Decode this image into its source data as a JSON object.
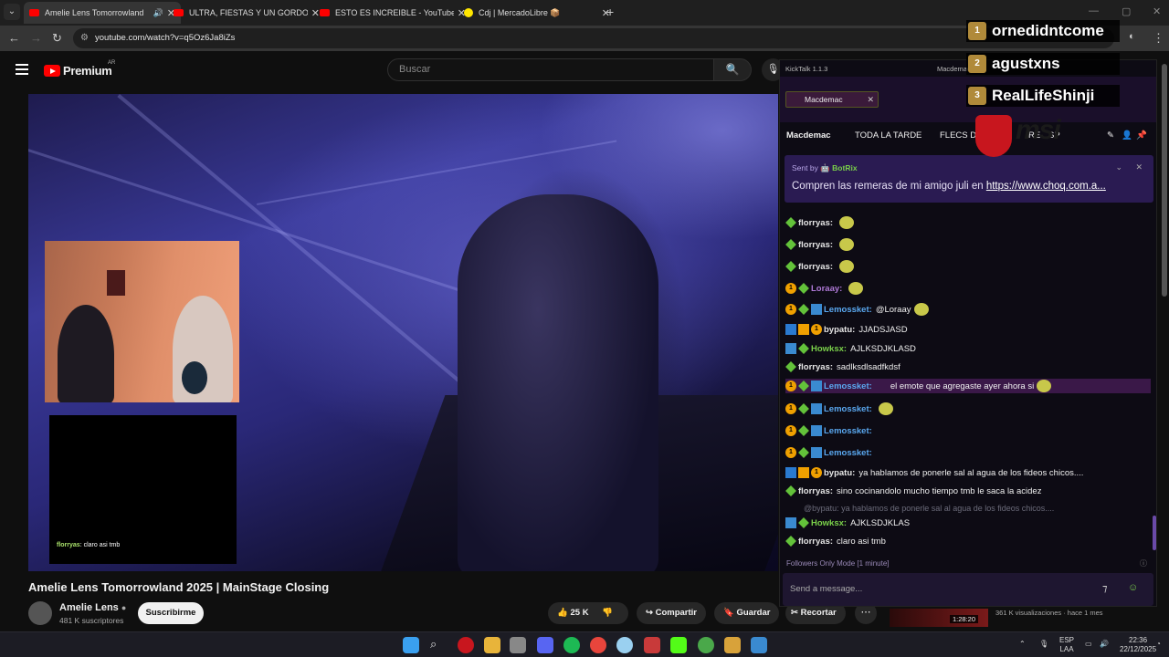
{
  "browser": {
    "tabs": [
      {
        "title": "Amelie Lens Tomorrowland",
        "active": true,
        "audio": true
      },
      {
        "title": "ULTRA, FIESTAS Y UN GORDO E",
        "active": false
      },
      {
        "title": "ESTO ES INCREIBLE - YouTube",
        "active": false
      },
      {
        "title": "Cdj | MercadoLibre 📦",
        "active": false
      }
    ],
    "url": "youtube.com/watch?v=q5Oz6Ja8iZs"
  },
  "youtube": {
    "logo_word": "Premium",
    "country_code": "AR",
    "search_placeholder": "Buscar",
    "video_title": "Amelie Lens Tomorrowland 2025 | MainStage Closing",
    "channel_name": "Amelie Lens",
    "subscribers": "481 K suscriptores",
    "subscribe_label": "Suscribirme",
    "likes": "25 K",
    "share_label": "Compartir",
    "save_label": "Guardar",
    "clip_label": "Recortar",
    "related": {
      "duration": "1:28:20",
      "meta": "361 K visualizaciones · hace 1 mes"
    }
  },
  "webcam_chat": {
    "user": "florryas",
    "text": ": claro asi tmb"
  },
  "kicktalk": {
    "app_title": "KickTalk 1.1.3",
    "window_title": "Macdemac",
    "tab_chip": "Macdemac",
    "nav": [
      "Macdemac",
      "TODA LA TARDE",
      "FLECS D",
      "RE",
      "SP"
    ],
    "pinned": {
      "sent_by": "Sent by",
      "bot": "BotRix",
      "message": "Compren las remeras de mi amigo juli en ",
      "link": "https://www.choq.com.a..."
    },
    "messages": [
      {
        "user": "florryas:",
        "color": "#e6e6e6",
        "text": ""
      },
      {
        "user": "florryas:",
        "color": "#e6e6e6",
        "text": ""
      },
      {
        "user": "florryas:",
        "color": "#e6e6e6",
        "text": ""
      },
      {
        "user": "Loraay:",
        "color": "#b07ad8",
        "text": ""
      },
      {
        "user": "Lemossket:",
        "color": "#5aa8f0",
        "text": "@Loraay"
      },
      {
        "user": "bypatu:",
        "color": "#e6e6e6",
        "text": "JJADSJASD"
      },
      {
        "user": "Howksx:",
        "color": "#7ad04a",
        "text": "AJLKSDJKLASD"
      },
      {
        "user": "florryas:",
        "color": "#e6e6e6",
        "text": "sadlksdlsadfkdsf"
      },
      {
        "user": "Lemossket:",
        "color": "#5aa8f0",
        "text": "el emote que agregaste ayer ahora si"
      },
      {
        "user": "Lemossket:",
        "color": "#5aa8f0",
        "text": ""
      },
      {
        "user": "Lemossket:",
        "color": "#5aa8f0",
        "text": ""
      },
      {
        "user": "Lemossket:",
        "color": "#5aa8f0",
        "text": ""
      },
      {
        "user": "bypatu:",
        "color": "#e6e6e6",
        "text": "ya hablamos de ponerle sal al agua de los fideos chicos...."
      },
      {
        "user": "florryas:",
        "color": "#e6e6e6",
        "text": "sino cocinandolo mucho tiempo tmb le saca la acidez"
      },
      {
        "user": "Howksx:",
        "color": "#7ad04a",
        "text": "AJKLSDJKLAS"
      },
      {
        "user": "florryas:",
        "color": "#e6e6e6",
        "text": "claro asi tmb"
      }
    ],
    "reply_preview": "@bypatu: ya hablamos de ponerle sal al agua de los fideos chicos....",
    "followers_mode": "Followers Only Mode [1 minute]",
    "input_placeholder": "Send a message..."
  },
  "overlay": {
    "top_gifters": [
      {
        "rank": "1",
        "name": "ornedidntcome"
      },
      {
        "rank": "2",
        "name": "agustxns"
      },
      {
        "rank": "3",
        "name": "RealLifeShinji"
      }
    ],
    "sponsor": "msi"
  },
  "taskbar": {
    "lang": "ESP",
    "layout": "LAA",
    "time": "22:36",
    "date": "22/12/2025"
  },
  "colors": {
    "kick_green": "#53fc18",
    "accent_purple": "#2a1b52",
    "youtube_red": "#ff0000"
  }
}
